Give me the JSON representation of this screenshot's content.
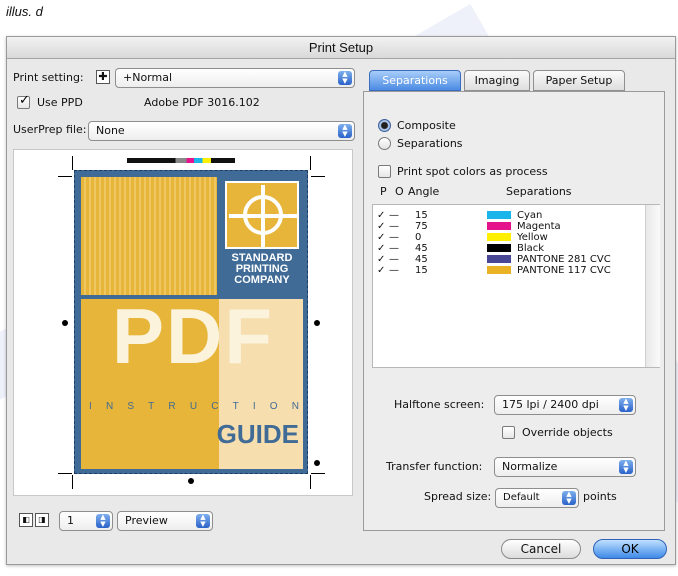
{
  "caption": "illus. d",
  "window": {
    "title": "Print Setup"
  },
  "left": {
    "print_setting_label": "Print setting:",
    "print_setting_value": "+Normal",
    "use_ppd_label": "Use PPD",
    "ppd_value": "Adobe PDF 3016.102",
    "userprep_label": "UserPrep file:",
    "userprep_value": "None",
    "preview_cover": {
      "logo_lines": [
        "STANDARD",
        "PRINTING",
        "COMPANY"
      ],
      "big_text": "PDF",
      "instruction_letters": [
        "I",
        "N",
        "S",
        "T",
        "R",
        "U",
        "C",
        "T",
        "I",
        "O",
        "N"
      ],
      "guide_text": "GUIDE"
    },
    "page_value": "1",
    "view_value": "Preview"
  },
  "tabs": [
    {
      "label": "Separations",
      "active": true
    },
    {
      "label": "Imaging",
      "active": false
    },
    {
      "label": "Paper Setup",
      "active": false
    }
  ],
  "separations": {
    "composite_label": "Composite",
    "separations_label": "Separations",
    "spot_label": "Print spot colors as process",
    "col_p": "P",
    "col_o": "O",
    "col_angle": "Angle",
    "col_separations": "Separations",
    "rows": [
      {
        "check": "✓",
        "dash": "—",
        "angle": "15",
        "name": "Cyan",
        "color": "#19b4ea"
      },
      {
        "check": "✓",
        "dash": "—",
        "angle": "75",
        "name": "Magenta",
        "color": "#e6148c"
      },
      {
        "check": "✓",
        "dash": "—",
        "angle": "0",
        "name": "Yellow",
        "color": "#ffef00"
      },
      {
        "check": "✓",
        "dash": "—",
        "angle": "45",
        "name": "Black",
        "color": "#000000"
      },
      {
        "check": "✓",
        "dash": "—",
        "angle": "45",
        "name": "PANTONE 281 CVC",
        "color": "#474796"
      },
      {
        "check": "✓",
        "dash": "—",
        "angle": "15",
        "name": "PANTONE 117 CVC",
        "color": "#e9b325"
      }
    ],
    "halftone_label": "Halftone screen:",
    "halftone_value": "175 lpi / 2400 dpi",
    "override_label": "Override objects",
    "transfer_label": "Transfer function:",
    "transfer_value": "Normalize",
    "spread_label": "Spread size:",
    "spread_value": "Default",
    "spread_unit": "points"
  },
  "buttons": {
    "cancel": "Cancel",
    "ok": "OK"
  },
  "colors": {
    "cover_blue": "#3f6b96",
    "cover_gold": "#e7b53a",
    "cover_light": "#f6deae",
    "accent": "#3e8ae8"
  }
}
